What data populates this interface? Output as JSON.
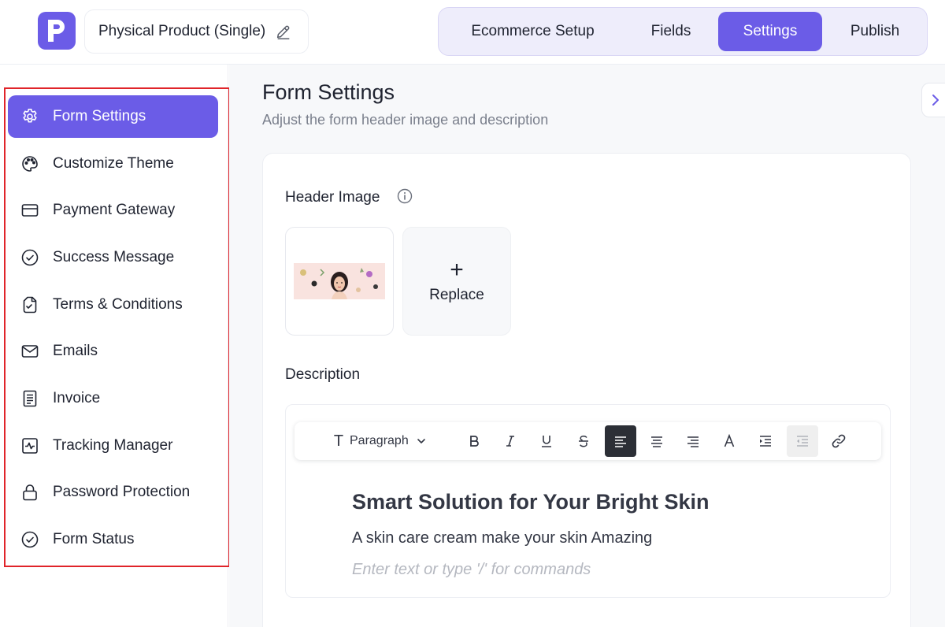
{
  "app": {
    "logo_letter": "P"
  },
  "header": {
    "form_name": "Physical Product (Single)"
  },
  "tabs": [
    {
      "label": "Ecommerce Setup",
      "active": false
    },
    {
      "label": "Fields",
      "active": false
    },
    {
      "label": "Settings",
      "active": true
    },
    {
      "label": "Publish",
      "active": false
    }
  ],
  "sidebar": {
    "items": [
      {
        "label": "Form Settings",
        "icon": "gear-icon",
        "active": true
      },
      {
        "label": "Customize Theme",
        "icon": "palette-icon",
        "active": false
      },
      {
        "label": "Payment Gateway",
        "icon": "credit-card-icon",
        "active": false
      },
      {
        "label": "Success Message",
        "icon": "check-circle-icon",
        "active": false
      },
      {
        "label": "Terms & Conditions",
        "icon": "document-icon",
        "active": false
      },
      {
        "label": "Emails",
        "icon": "mail-icon",
        "active": false
      },
      {
        "label": "Invoice",
        "icon": "invoice-icon",
        "active": false
      },
      {
        "label": "Tracking Manager",
        "icon": "activity-icon",
        "active": false
      },
      {
        "label": "Password Protection",
        "icon": "lock-icon",
        "active": false
      },
      {
        "label": "Form Status",
        "icon": "check-circle-icon",
        "active": false
      }
    ]
  },
  "main": {
    "title": "Form Settings",
    "subtitle": "Adjust the form header image and description",
    "header_image": {
      "label": "Header Image",
      "replace_label": "Replace",
      "replace_symbol": "+"
    },
    "description": {
      "label": "Description",
      "toolbar": {
        "block_type": "Paragraph",
        "text_icon": "T"
      },
      "heading": "Smart Solution for Your Bright Skin",
      "paragraph": "A skin care cream make your skin Amazing",
      "placeholder": "Enter text or type '/' for commands"
    }
  },
  "colors": {
    "accent": "#6b5ce7",
    "highlight_outline": "#e0242a"
  }
}
